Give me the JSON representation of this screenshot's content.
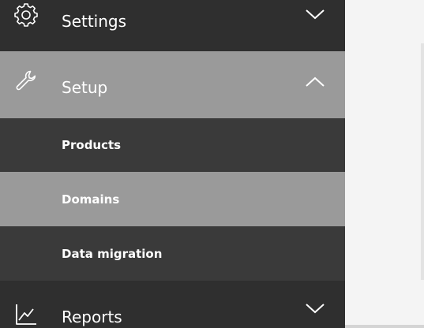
{
  "sidebar": {
    "items": [
      {
        "label": "Settings",
        "icon": "gear-icon",
        "chevron": "chevron-down-icon"
      },
      {
        "label": "Setup",
        "icon": "wrench-icon",
        "chevron": "chevron-up-icon"
      },
      {
        "label": "Reports",
        "icon": "line-chart-icon",
        "chevron": "chevron-down-icon"
      }
    ],
    "setup_subitems": [
      {
        "label": "Products"
      },
      {
        "label": "Domains"
      },
      {
        "label": "Data migration"
      }
    ],
    "selected_subitem": "Domains"
  },
  "colors": {
    "sidebar_bg": "#2f2f2f",
    "expanded_bg": "#9a9a9a",
    "subitem_bg": "#3a3a3a",
    "selected_bg": "#9a9a9a",
    "text": "#ffffff",
    "content_bg": "#f4f4f4"
  }
}
